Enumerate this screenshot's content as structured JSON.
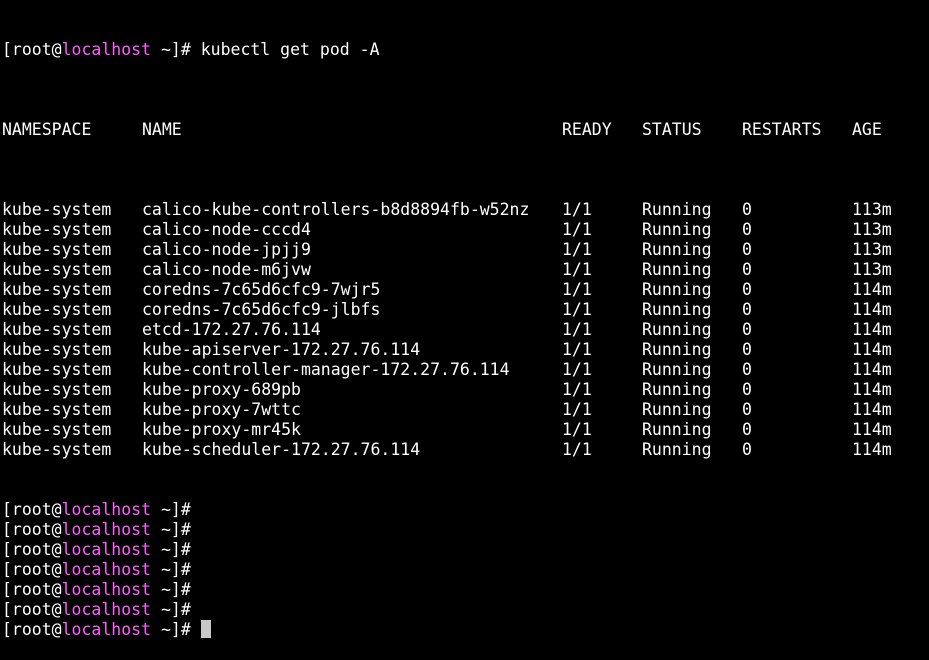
{
  "colors": {
    "background": "#000000",
    "text": "#ffffff",
    "hostname": "#ff5fff",
    "cursor": "#c8c8c8"
  },
  "prompt": {
    "open": "[root@",
    "host": "localhost",
    "close": " ~]#"
  },
  "command": "kubectl get pod -A",
  "table": {
    "headers": {
      "namespace": "NAMESPACE",
      "name": "NAME",
      "ready": "READY",
      "status": "STATUS",
      "restarts": "RESTARTS",
      "age": "AGE"
    },
    "rows": [
      {
        "namespace": "kube-system",
        "name": "calico-kube-controllers-b8d8894fb-w52nz",
        "ready": "1/1",
        "status": "Running",
        "restarts": "0",
        "age": "113m"
      },
      {
        "namespace": "kube-system",
        "name": "calico-node-cccd4",
        "ready": "1/1",
        "status": "Running",
        "restarts": "0",
        "age": "113m"
      },
      {
        "namespace": "kube-system",
        "name": "calico-node-jpjj9",
        "ready": "1/1",
        "status": "Running",
        "restarts": "0",
        "age": "113m"
      },
      {
        "namespace": "kube-system",
        "name": "calico-node-m6jvw",
        "ready": "1/1",
        "status": "Running",
        "restarts": "0",
        "age": "113m"
      },
      {
        "namespace": "kube-system",
        "name": "coredns-7c65d6cfc9-7wjr5",
        "ready": "1/1",
        "status": "Running",
        "restarts": "0",
        "age": "114m"
      },
      {
        "namespace": "kube-system",
        "name": "coredns-7c65d6cfc9-jlbfs",
        "ready": "1/1",
        "status": "Running",
        "restarts": "0",
        "age": "114m"
      },
      {
        "namespace": "kube-system",
        "name": "etcd-172.27.76.114",
        "ready": "1/1",
        "status": "Running",
        "restarts": "0",
        "age": "114m"
      },
      {
        "namespace": "kube-system",
        "name": "kube-apiserver-172.27.76.114",
        "ready": "1/1",
        "status": "Running",
        "restarts": "0",
        "age": "114m"
      },
      {
        "namespace": "kube-system",
        "name": "kube-controller-manager-172.27.76.114",
        "ready": "1/1",
        "status": "Running",
        "restarts": "0",
        "age": "114m"
      },
      {
        "namespace": "kube-system",
        "name": "kube-proxy-689pb",
        "ready": "1/1",
        "status": "Running",
        "restarts": "0",
        "age": "114m"
      },
      {
        "namespace": "kube-system",
        "name": "kube-proxy-7wttc",
        "ready": "1/1",
        "status": "Running",
        "restarts": "0",
        "age": "114m"
      },
      {
        "namespace": "kube-system",
        "name": "kube-proxy-mr45k",
        "ready": "1/1",
        "status": "Running",
        "restarts": "0",
        "age": "114m"
      },
      {
        "namespace": "kube-system",
        "name": "kube-scheduler-172.27.76.114",
        "ready": "1/1",
        "status": "Running",
        "restarts": "0",
        "age": "114m"
      }
    ]
  },
  "empty_prompt_count": 7
}
